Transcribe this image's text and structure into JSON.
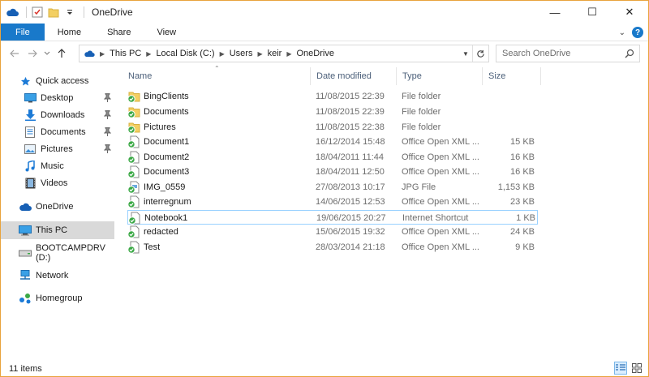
{
  "window": {
    "title": "OneDrive",
    "accent_border": "#e8a33d",
    "controls": {
      "minimize": "—",
      "maximize": "☐",
      "close": "✕"
    }
  },
  "ribbon": {
    "tabs": [
      {
        "label": "File"
      },
      {
        "label": "Home"
      },
      {
        "label": "Share"
      },
      {
        "label": "View"
      }
    ],
    "collapse_glyph": "⌄",
    "help_glyph": "?"
  },
  "address_bar": {
    "breadcrumbs": [
      "This PC",
      "Local Disk (C:)",
      "Users",
      "keir",
      "OneDrive"
    ],
    "search_placeholder": "Search OneDrive"
  },
  "nav_pane": {
    "items": [
      {
        "label": "Quick access",
        "icon": "star-icon",
        "pinned": false
      },
      {
        "label": "Desktop",
        "icon": "desktop-icon",
        "pinned": true
      },
      {
        "label": "Downloads",
        "icon": "download-icon",
        "pinned": true
      },
      {
        "label": "Documents",
        "icon": "documents-icon",
        "pinned": true
      },
      {
        "label": "Pictures",
        "icon": "pictures-icon",
        "pinned": true
      },
      {
        "label": "Music",
        "icon": "music-icon",
        "pinned": false
      },
      {
        "label": "Videos",
        "icon": "videos-icon",
        "pinned": false
      },
      {
        "label": "OneDrive",
        "icon": "cloud-icon",
        "pinned": false
      },
      {
        "label": "This PC",
        "icon": "computer-icon",
        "pinned": false,
        "selected": true
      },
      {
        "label": "BOOTCAMPDRV (D:)",
        "icon": "drive-icon",
        "pinned": false
      },
      {
        "label": "Network",
        "icon": "network-icon",
        "pinned": false
      },
      {
        "label": "Homegroup",
        "icon": "homegroup-icon",
        "pinned": false
      }
    ]
  },
  "file_list": {
    "columns": [
      "Name",
      "Date modified",
      "Type",
      "Size"
    ],
    "rows": [
      {
        "name": "BingClients",
        "date": "11/08/2015 22:39",
        "type": "File folder",
        "size": "",
        "kind": "folder"
      },
      {
        "name": "Documents",
        "date": "11/08/2015 22:39",
        "type": "File folder",
        "size": "",
        "kind": "folder"
      },
      {
        "name": "Pictures",
        "date": "11/08/2015 22:38",
        "type": "File folder",
        "size": "",
        "kind": "folder"
      },
      {
        "name": "Document1",
        "date": "16/12/2014 15:48",
        "type": "Office Open XML ...",
        "size": "15 KB",
        "kind": "file"
      },
      {
        "name": "Document2",
        "date": "18/04/2011 11:44",
        "type": "Office Open XML ...",
        "size": "16 KB",
        "kind": "file"
      },
      {
        "name": "Document3",
        "date": "18/04/2011 12:50",
        "type": "Office Open XML ...",
        "size": "16 KB",
        "kind": "file"
      },
      {
        "name": "IMG_0559",
        "date": "27/08/2013 10:17",
        "type": "JPG File",
        "size": "1,153 KB",
        "kind": "file"
      },
      {
        "name": "interregnum",
        "date": "14/06/2015 12:53",
        "type": "Office Open XML ...",
        "size": "23 KB",
        "kind": "file"
      },
      {
        "name": "Notebook1",
        "date": "19/06/2015 20:27",
        "type": "Internet Shortcut",
        "size": "1 KB",
        "kind": "file",
        "focused": true
      },
      {
        "name": "redacted",
        "date": "15/06/2015 19:32",
        "type": "Office Open XML ...",
        "size": "24 KB",
        "kind": "file"
      },
      {
        "name": "Test",
        "date": "28/03/2014 21:18",
        "type": "Office Open XML ...",
        "size": "9 KB",
        "kind": "file"
      }
    ]
  },
  "status_bar": {
    "item_count": "11 items"
  },
  "colors": {
    "file_tab": "#1979ca",
    "sync_check": "#3aa845",
    "folder": "#f3cf62",
    "header_text": "#4c607a"
  }
}
